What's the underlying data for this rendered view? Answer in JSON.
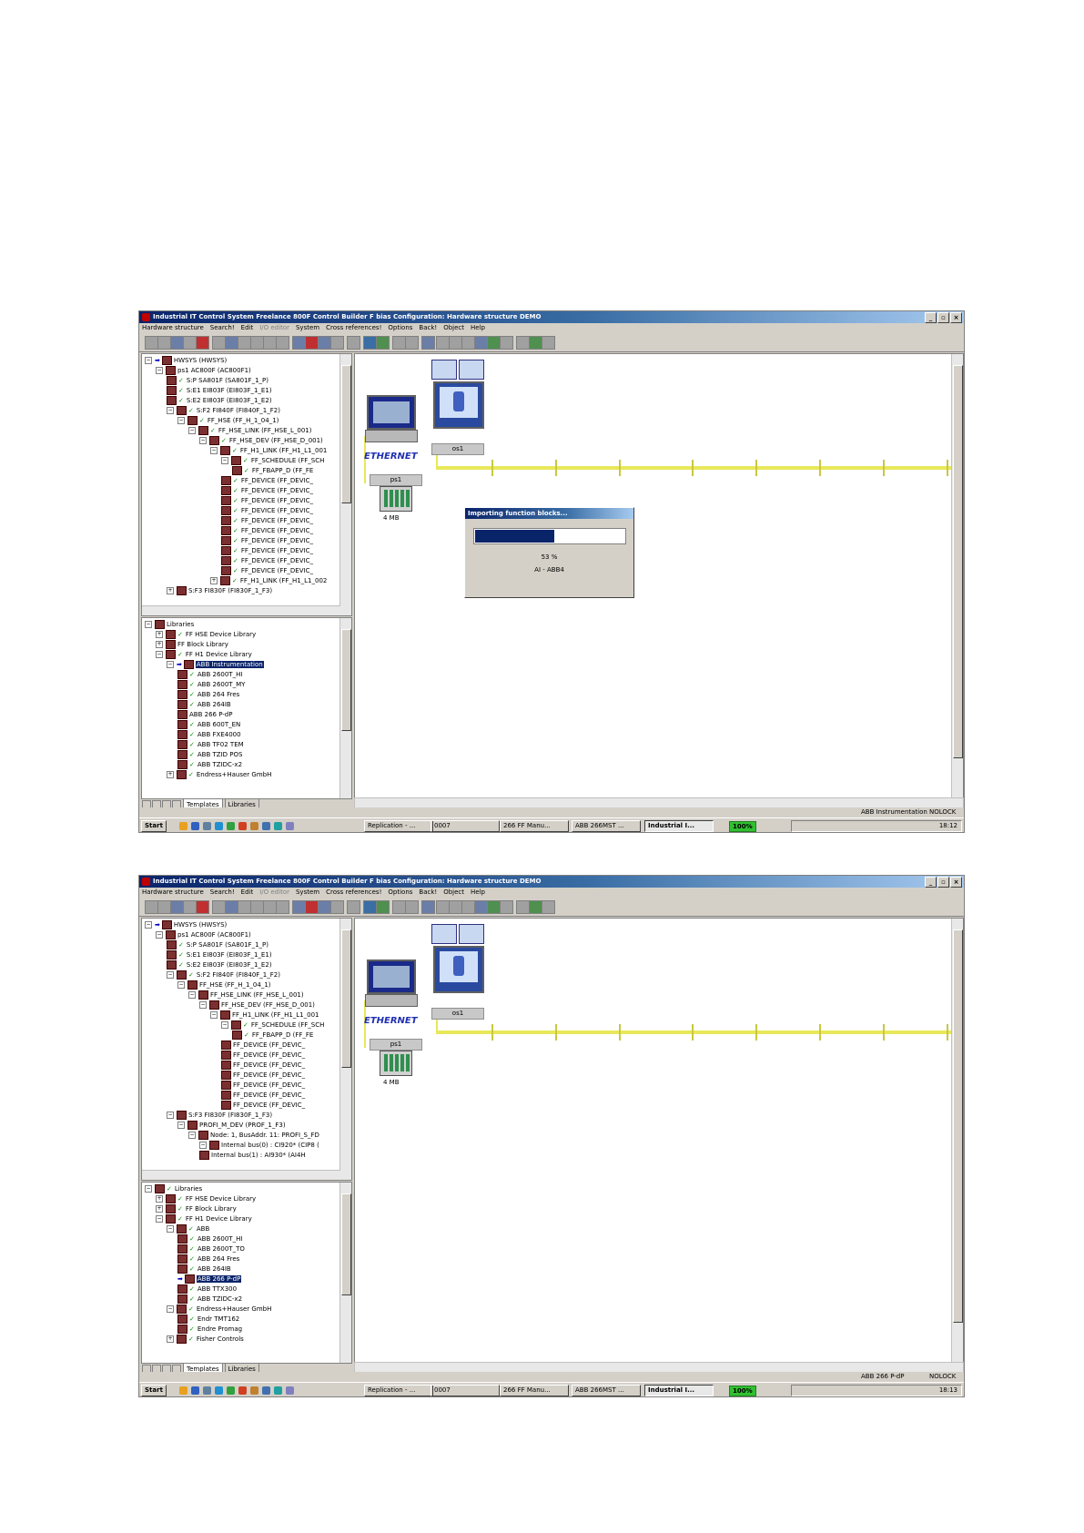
{
  "colors": {
    "title_dark": "#0a246a",
    "title_light": "#a6caf0",
    "bus": "#e8e85a",
    "check": "#009000",
    "selection": "#0a246a"
  },
  "window_controls": [
    "_",
    "▫",
    "×"
  ],
  "screenshots": [
    {
      "title": "Industrial IT Control System Freelance 800F Control Builder F bias  Configuration: Hardware structure  DEMO",
      "menu": [
        "Hardware structure",
        "Search!",
        "Edit",
        "I/O editor",
        "System",
        "Cross references!",
        "Options",
        "Back!",
        "Object",
        "Help"
      ],
      "tree": [
        {
          "text": "HWSYS (HWSYS)",
          "indent": 0,
          "node": "-",
          "arrow": true
        },
        {
          "text": "ps1   AC800F (AC800F1)",
          "indent": 1,
          "node": "-"
        },
        {
          "text": "S:P  SA801F (SA801F_1_P)",
          "indent": 2,
          "check": true
        },
        {
          "text": "S:E1  EI803F (EI803F_1_E1)",
          "indent": 2,
          "check": true
        },
        {
          "text": "S:E2  EI803F (EI803F_1_E2)",
          "indent": 2,
          "check": true
        },
        {
          "text": "S:F2  FI840F (FI840F_1_F2)",
          "indent": 2,
          "node": "-",
          "check": true
        },
        {
          "text": "FF_HSE (FF_H_1_04_1)",
          "indent": 3,
          "node": "-",
          "check": true
        },
        {
          "text": "FF_HSE_LINK (FF_HSE_L_001)",
          "indent": 4,
          "node": "-",
          "check": true
        },
        {
          "text": "FF_HSE_DEV (FF_HSE_D_001)",
          "indent": 5,
          "node": "-",
          "check": true
        },
        {
          "text": "FF_H1_LINK (FF_H1_L1_001",
          "indent": 6,
          "node": "-",
          "check": true
        },
        {
          "text": "FF_SCHEDULE (FF_SCH",
          "indent": 7,
          "node": "-",
          "check": true
        },
        {
          "text": "FF_FBAPP_D (FF_FE",
          "indent": 8,
          "check": true
        },
        {
          "text": "FF_DEVICE (FF_DEVIC_",
          "indent": 7,
          "check": true
        },
        {
          "text": "FF_DEVICE (FF_DEVIC_",
          "indent": 7,
          "check": true
        },
        {
          "text": "FF_DEVICE (FF_DEVIC_",
          "indent": 7,
          "check": true
        },
        {
          "text": "FF_DEVICE (FF_DEVIC_",
          "indent": 7,
          "check": true
        },
        {
          "text": "FF_DEVICE (FF_DEVIC_",
          "indent": 7,
          "check": true
        },
        {
          "text": "FF_DEVICE (FF_DEVIC_",
          "indent": 7,
          "check": true
        },
        {
          "text": "FF_DEVICE (FF_DEVIC_",
          "indent": 7,
          "check": true
        },
        {
          "text": "FF_DEVICE (FF_DEVIC_",
          "indent": 7,
          "check": true
        },
        {
          "text": "FF_DEVICE (FF_DEVIC_",
          "indent": 7,
          "check": true
        },
        {
          "text": "FF_DEVICE (FF_DEVIC_",
          "indent": 7,
          "check": true
        },
        {
          "text": "FF_H1_LINK (FF_H1_L1_002",
          "indent": 6,
          "node": "+",
          "check": true
        },
        {
          "text": "S:F3  FI830F (FI830F_1_F3)",
          "indent": 2,
          "node": "+"
        }
      ],
      "libraries": [
        {
          "text": "Libraries",
          "indent": 0,
          "node": "-"
        },
        {
          "text": "FF HSE Device Library",
          "indent": 1,
          "node": "+",
          "check": true
        },
        {
          "text": "FF Block Library",
          "indent": 1,
          "node": "+"
        },
        {
          "text": "FF H1 Device Library",
          "indent": 1,
          "node": "-",
          "check": true
        },
        {
          "text": "ABB Instrumentation",
          "indent": 2,
          "node": "-",
          "arrow": true,
          "selected": true
        },
        {
          "text": "ABB 2600T_HI",
          "indent": 3,
          "check": true
        },
        {
          "text": "ABB 2600T_MY",
          "indent": 3,
          "check": true
        },
        {
          "text": "ABB 264 Fres",
          "indent": 3,
          "check": true
        },
        {
          "text": "ABB 264IB",
          "indent": 3,
          "check": true
        },
        {
          "text": "ABB 266 P-dP",
          "indent": 3
        },
        {
          "text": "ABB 600T_EN",
          "indent": 3,
          "check": true
        },
        {
          "text": "ABB FXE4000",
          "indent": 3,
          "check": true
        },
        {
          "text": "ABB TF02 TEM",
          "indent": 3,
          "check": true
        },
        {
          "text": "ABB TZID POS",
          "indent": 3,
          "check": true
        },
        {
          "text": "ABB TZIDC-x2",
          "indent": 3,
          "check": true
        },
        {
          "text": "Endress+Hauser GmbH",
          "indent": 2,
          "node": "+",
          "check": true
        }
      ],
      "tabs": [
        "Templates",
        "Libraries"
      ],
      "ethernet_label": "ETHERNET",
      "os_label": "os1",
      "ps_label": "ps1",
      "memory": "4 MB",
      "dialog": {
        "title": "Importing function blocks...",
        "progress": 0.53,
        "percent": "53 %",
        "item": "AI - ABB4"
      },
      "status": {
        "object": "ABB Instrumentation",
        "lock": "NOLOCK"
      },
      "taskbar": {
        "start": "Start",
        "tasks": [
          "Replication - ...",
          "0007",
          "266 FF Manu...",
          "ABB 266MST ...",
          "Industrial I..."
        ],
        "zoom": "100%",
        "clock": "18:12"
      }
    },
    {
      "title": "Industrial IT Control System Freelance 800F Control Builder F bias  Configuration: Hardware structure  DEMO",
      "menu": [
        "Hardware structure",
        "Search!",
        "Edit",
        "I/O editor",
        "System",
        "Cross references!",
        "Options",
        "Back!",
        "Object",
        "Help"
      ],
      "tree": [
        {
          "text": "HWSYS (HWSYS)",
          "indent": 0,
          "node": "-",
          "arrow": true
        },
        {
          "text": "ps1   AC800F (AC800F1)",
          "indent": 1,
          "node": "-"
        },
        {
          "text": "S:P  SA801F (SA801F_1_P)",
          "indent": 2,
          "check": true
        },
        {
          "text": "S:E1  EI803F (EI803F_1_E1)",
          "indent": 2,
          "check": true
        },
        {
          "text": "S:E2  EI803F (EI803F_1_E2)",
          "indent": 2,
          "check": true
        },
        {
          "text": "S:F2  FI840F (FI840F_1_F2)",
          "indent": 2,
          "node": "-",
          "check": true
        },
        {
          "text": "FF_HSE (FF_H_1_04_1)",
          "indent": 3,
          "node": "-"
        },
        {
          "text": "FF_HSE_LINK (FF_HSE_L_001)",
          "indent": 4,
          "node": "-"
        },
        {
          "text": "FF_HSE_DEV (FF_HSE_D_001)",
          "indent": 5,
          "node": "-"
        },
        {
          "text": "FF_H1_LINK (FF_H1_L1_001",
          "indent": 6,
          "node": "-"
        },
        {
          "text": "FF_SCHEDULE (FF_SCH",
          "indent": 7,
          "node": "-",
          "check": true
        },
        {
          "text": "FF_FBAPP_D (FF_FE",
          "indent": 8,
          "check": true
        },
        {
          "text": "FF_DEVICE (FF_DEVIC_",
          "indent": 7
        },
        {
          "text": "FF_DEVICE (FF_DEVIC_",
          "indent": 7
        },
        {
          "text": "FF_DEVICE (FF_DEVIC_",
          "indent": 7
        },
        {
          "text": "FF_DEVICE (FF_DEVIC_",
          "indent": 7
        },
        {
          "text": "FF_DEVICE (FF_DEVIC_",
          "indent": 7
        },
        {
          "text": "FF_DEVICE (FF_DEVIC_",
          "indent": 7
        },
        {
          "text": "FF_DEVICE (FF_DEVIC_",
          "indent": 7
        },
        {
          "text": "S:F3  FI830F (FI830F_1_F3)",
          "indent": 2,
          "node": "-"
        },
        {
          "text": "PROFI_M_DEV (PROF_1_F3)",
          "indent": 3,
          "node": "-"
        },
        {
          "text": "Node: 1, BusAddr. 11: PROFI_S_FD",
          "indent": 4,
          "node": "-"
        },
        {
          "text": "Internal bus(0) : CI920* (CIP8 (",
          "indent": 5,
          "node": "-"
        },
        {
          "text": "Internal bus(1) : AI930* (AI4H",
          "indent": 5
        }
      ],
      "libraries": [
        {
          "text": "Libraries",
          "indent": 0,
          "node": "-",
          "check": true
        },
        {
          "text": "FF HSE Device Library",
          "indent": 1,
          "node": "+",
          "check": true
        },
        {
          "text": "FF Block Library",
          "indent": 1,
          "node": "+",
          "check": true
        },
        {
          "text": "FF H1 Device Library",
          "indent": 1,
          "node": "-",
          "check": true
        },
        {
          "text": "ABB",
          "indent": 2,
          "node": "-",
          "check": true
        },
        {
          "text": "ABB 2600T_HI",
          "indent": 3,
          "check": true
        },
        {
          "text": "ABB 2600T_TO",
          "indent": 3,
          "check": true
        },
        {
          "text": "ABB 264 Fres",
          "indent": 3,
          "check": true
        },
        {
          "text": "ABB 264IB",
          "indent": 3,
          "check": true
        },
        {
          "text": "ABB 266 P-dP",
          "indent": 3,
          "arrow": true,
          "selected": true
        },
        {
          "text": "ABB TTX300",
          "indent": 3,
          "check": true
        },
        {
          "text": "ABB TZIDC-x2",
          "indent": 3,
          "check": true
        },
        {
          "text": "Endress+Hauser GmbH",
          "indent": 2,
          "node": "-",
          "check": true
        },
        {
          "text": "Endr TMT162",
          "indent": 3,
          "check": true
        },
        {
          "text": "Endre Promag",
          "indent": 3,
          "check": true
        },
        {
          "text": "Fisher Controls",
          "indent": 2,
          "node": "+",
          "check": true
        }
      ],
      "tabs": [
        "Templates",
        "Libraries"
      ],
      "ethernet_label": "ETHERNET",
      "os_label": "os1",
      "ps_label": "ps1",
      "memory": "4 MB",
      "status": {
        "object": "ABB 266 P-dP",
        "lock": "NOLOCK"
      },
      "taskbar": {
        "start": "Start",
        "tasks": [
          "Replication - ...",
          "0007",
          "266 FF Manu...",
          "ABB 266MST ...",
          "Industrial I..."
        ],
        "zoom": "100%",
        "clock": "18:13"
      }
    }
  ]
}
